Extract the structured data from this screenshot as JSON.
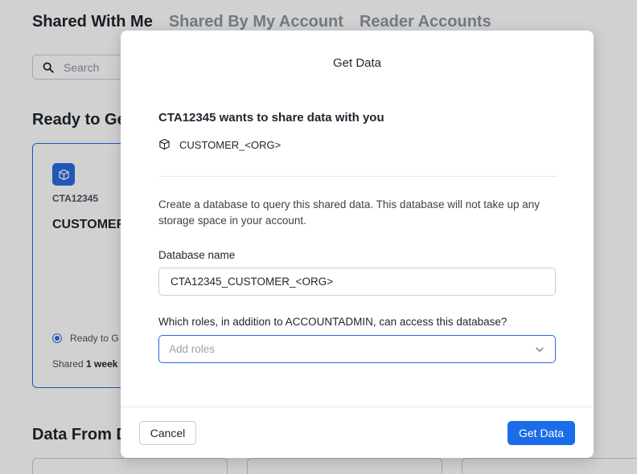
{
  "background": {
    "tabs": [
      {
        "label": "Shared With Me",
        "active": true
      },
      {
        "label": "Shared By My Account",
        "active": false
      },
      {
        "label": "Reader Accounts",
        "active": false
      }
    ],
    "search": {
      "placeholder": "Search"
    },
    "ready_section_title": "Ready to Ge",
    "data_section_title": "Data From D",
    "card": {
      "provider": "CTA12345",
      "name": "CUSTOMER",
      "status": "Ready to G",
      "shared_prefix": "Shared",
      "shared_age": "1 week"
    }
  },
  "modal": {
    "title": "Get Data",
    "share_heading": "CTA12345 wants to share data with you",
    "share_item": {
      "icon": "cube-icon",
      "label": "CUSTOMER_<ORG>"
    },
    "description": "Create a database to query this shared data. This database will not take up any storage space in your account.",
    "database_name": {
      "label": "Database name",
      "value": "CTA12345_CUSTOMER_<ORG>"
    },
    "roles": {
      "label": "Which roles, in addition to ACCOUNTADMIN, can access this database?",
      "placeholder": "Add roles"
    },
    "buttons": {
      "cancel": "Cancel",
      "primary": "Get Data"
    }
  },
  "colors": {
    "accent": "#1a6ce8",
    "border": "#c8ccd2",
    "text": "#1e252d"
  }
}
